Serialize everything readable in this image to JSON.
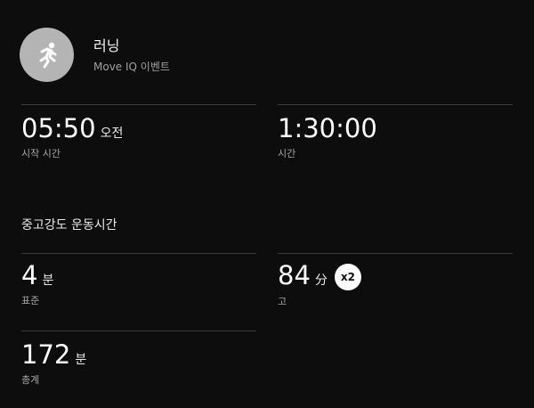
{
  "activity": {
    "title": "러닝",
    "subtitle": "Move IQ 이벤트",
    "icon": "running-person-icon"
  },
  "start_time": {
    "value": "05:50",
    "unit": "오전",
    "label": "시작 시간"
  },
  "duration": {
    "value": "1:30:00",
    "label": "시간"
  },
  "intensity": {
    "title": "중고강도 운동시간",
    "moderate": {
      "value": "4",
      "unit": "분",
      "label": "표준"
    },
    "vigorous": {
      "value": "84",
      "unit": "分",
      "label": "고",
      "badge": "x2"
    },
    "total": {
      "value": "172",
      "unit": "분",
      "label": "총계"
    }
  },
  "colors": {
    "background": "#0d0d0d",
    "divider": "#3a3a3a",
    "avatar": "#b4b4b4",
    "badge": "#ffffff"
  }
}
